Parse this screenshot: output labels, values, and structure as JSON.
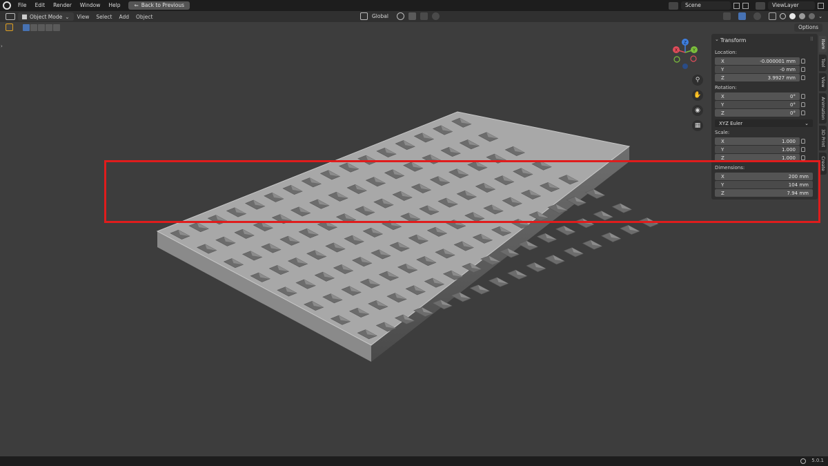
{
  "topbar": {
    "menus": [
      "File",
      "Edit",
      "Render",
      "Window",
      "Help"
    ],
    "back_button": "Back to Previous",
    "scene": "Scene",
    "view_layer": "ViewLayer"
  },
  "header": {
    "mode": "Object Mode",
    "menus": [
      "View",
      "Select",
      "Add",
      "Object"
    ],
    "orientation": "Global",
    "options_label": "Options"
  },
  "panel": {
    "title": "Transform",
    "location": {
      "label": "Location:",
      "x": {
        "axis": "X",
        "value": "-0.000001 mm"
      },
      "y": {
        "axis": "Y",
        "value": "-0 mm"
      },
      "z": {
        "axis": "Z",
        "value": "3.9927 mm"
      }
    },
    "rotation": {
      "label": "Rotation:",
      "x": {
        "axis": "X",
        "value": "0°"
      },
      "y": {
        "axis": "Y",
        "value": "0°"
      },
      "z": {
        "axis": "Z",
        "value": "0°"
      }
    },
    "rotation_mode": "XYZ Euler",
    "scale": {
      "label": "Scale:",
      "x": {
        "axis": "X",
        "value": "1.000"
      },
      "y": {
        "axis": "Y",
        "value": "1.000"
      },
      "z": {
        "axis": "Z",
        "value": "1.000"
      }
    },
    "dimensions": {
      "label": "Dimensions:",
      "x": {
        "axis": "X",
        "value": "200 mm"
      },
      "y": {
        "axis": "Y",
        "value": "104 mm"
      },
      "z": {
        "axis": "Z",
        "value": "7.94 mm"
      }
    }
  },
  "tabs": [
    "Item",
    "Tool",
    "View",
    "Animation",
    "3D Print",
    "Create"
  ],
  "gizmo": {
    "x": "X",
    "y": "Y",
    "z": "Z"
  },
  "status": {
    "version": "5.0.1"
  },
  "colors": {
    "highlight": "#e01c1c",
    "x_axis": "#e04c5a",
    "y_axis": "#7cbf3c",
    "z_axis": "#3e7fe0"
  }
}
